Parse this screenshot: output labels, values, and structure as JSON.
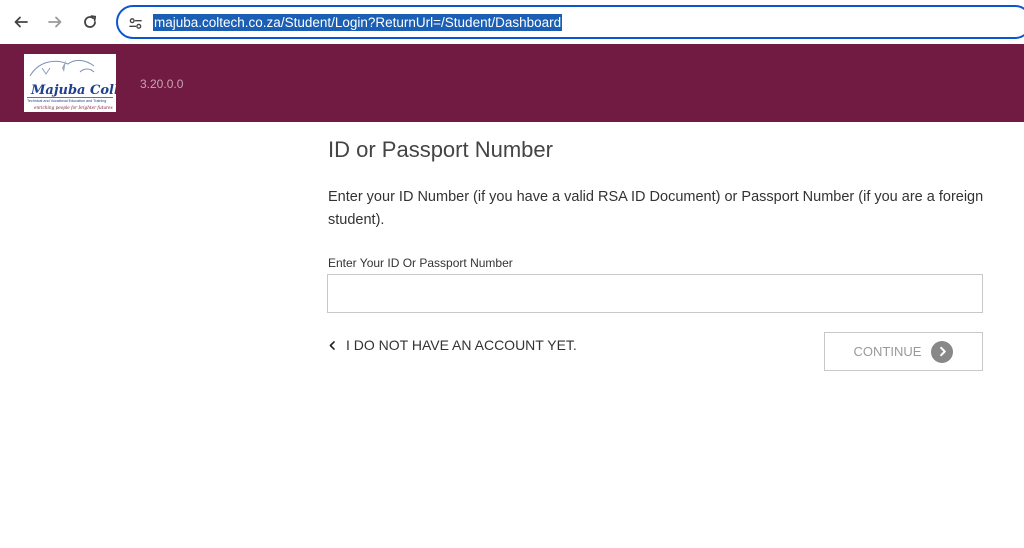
{
  "browser": {
    "url": "majuba.coltech.co.za/Student/Login?ReturnUrl=/Student/Dashboard",
    "icons": {
      "back": "arrow-left-icon",
      "forward": "arrow-right-icon",
      "reload": "reload-icon",
      "site_info": "tune-icon"
    }
  },
  "header": {
    "background_color": "#721b42",
    "version": "3.20.0.0",
    "logo": {
      "name": "Majuba College",
      "tagline": "Technical and Vocational Education and Training",
      "motto": "enriching people for brighter futures"
    }
  },
  "form": {
    "title": "ID or Passport Number",
    "description": "Enter your ID Number (if you have a valid RSA ID Document) or Passport Number (if you are a foreign student).",
    "field_label": "Enter Your ID Or Passport Number",
    "field_value": "",
    "back_link": "I DO NOT HAVE AN ACCOUNT YET.",
    "continue_label": "CONTINUE"
  }
}
